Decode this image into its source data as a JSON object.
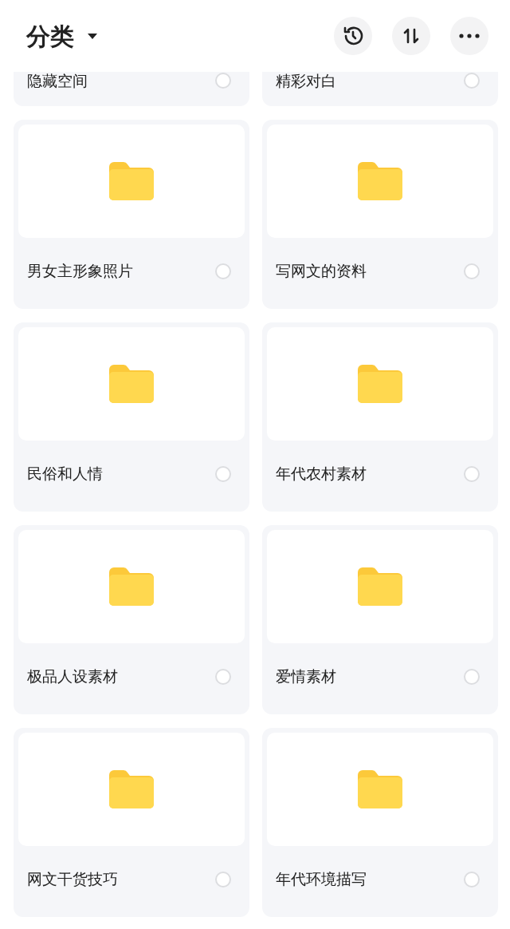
{
  "header": {
    "title": "分类"
  },
  "folders": [
    {
      "name": "隐藏空间",
      "selected": false
    },
    {
      "name": "精彩对白",
      "selected": false
    },
    {
      "name": "男女主形象照片",
      "selected": false
    },
    {
      "name": "写网文的资料",
      "selected": false
    },
    {
      "name": "民俗和人情",
      "selected": false
    },
    {
      "name": "年代农村素材",
      "selected": false
    },
    {
      "name": "极品人设素材",
      "selected": false
    },
    {
      "name": "爱情素材",
      "selected": false
    },
    {
      "name": "网文干货技巧",
      "selected": false
    },
    {
      "name": "年代环境描写",
      "selected": false
    }
  ]
}
